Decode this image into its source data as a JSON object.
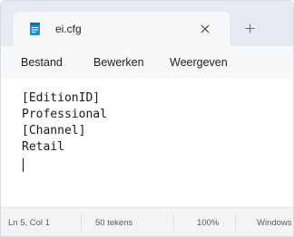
{
  "tab": {
    "title": "ei.cfg",
    "icon": "notepad-icon",
    "close_icon": "close-icon",
    "new_tab_icon": "plus-icon"
  },
  "menu": {
    "file": "Bestand",
    "edit": "Bewerken",
    "view": "Weergeven"
  },
  "editor": {
    "lines": [
      "[EditionID]",
      "Professional",
      "[Channel]",
      "Retail",
      ""
    ]
  },
  "status": {
    "position": "Ln 5, Col 1",
    "count": "50 tekens",
    "zoom": "100%",
    "line_ending": "Windows"
  },
  "colors": {
    "tab_strip": "#e6ebf2",
    "tab_active": "#f7f8fa",
    "editor_bg": "#ffffff",
    "statusbar": "#f3f4f6",
    "icon_accent": "#1e8fd1"
  }
}
